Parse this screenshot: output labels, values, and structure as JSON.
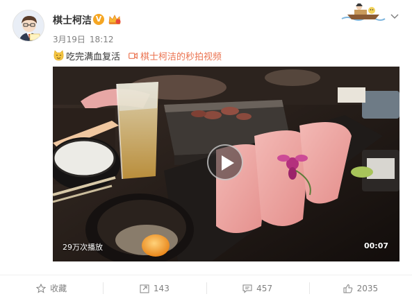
{
  "post": {
    "username": "棋士柯洁",
    "verified_badge": "V",
    "date": "3月19日",
    "time": "18:12",
    "text": "吃完满血复活",
    "video_link_label": "棋士柯洁的秒拍视频",
    "emoji": "cat-face-emoji"
  },
  "video": {
    "views": "29万次播放",
    "duration": "00:07"
  },
  "actions": {
    "favorite_label": "收藏",
    "repost_count": "143",
    "comment_count": "457",
    "like_count": "2035"
  },
  "colors": {
    "link": "#eb7350",
    "meta": "#808080",
    "badge": "#f5a623"
  }
}
